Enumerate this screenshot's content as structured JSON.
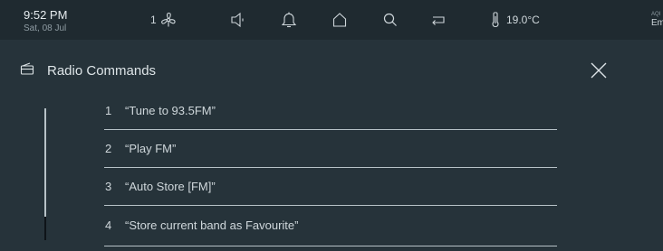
{
  "status": {
    "time": "9:52 PM",
    "date": "Sat, 08 Jul",
    "fan_speed": "1",
    "temperature": "19.0°C",
    "edge_line1": "AQI",
    "edge_line2": "Em"
  },
  "icons": {
    "fan": "fan-icon",
    "volume": "volume-icon",
    "notifications": "bell-icon",
    "home": "home-icon",
    "search": "search-icon",
    "return": "return-icon",
    "thermometer": "thermometer-icon",
    "radio": "radio-icon",
    "close": "close-icon"
  },
  "panel": {
    "title": "Radio Commands"
  },
  "commands": [
    {
      "num": "1",
      "text": "“Tune to 93.5FM”"
    },
    {
      "num": "2",
      "text": "“Play FM”"
    },
    {
      "num": "3",
      "text": "“Auto Store [FM]”"
    },
    {
      "num": "4",
      "text": "“Store current band as Favourite”"
    }
  ]
}
